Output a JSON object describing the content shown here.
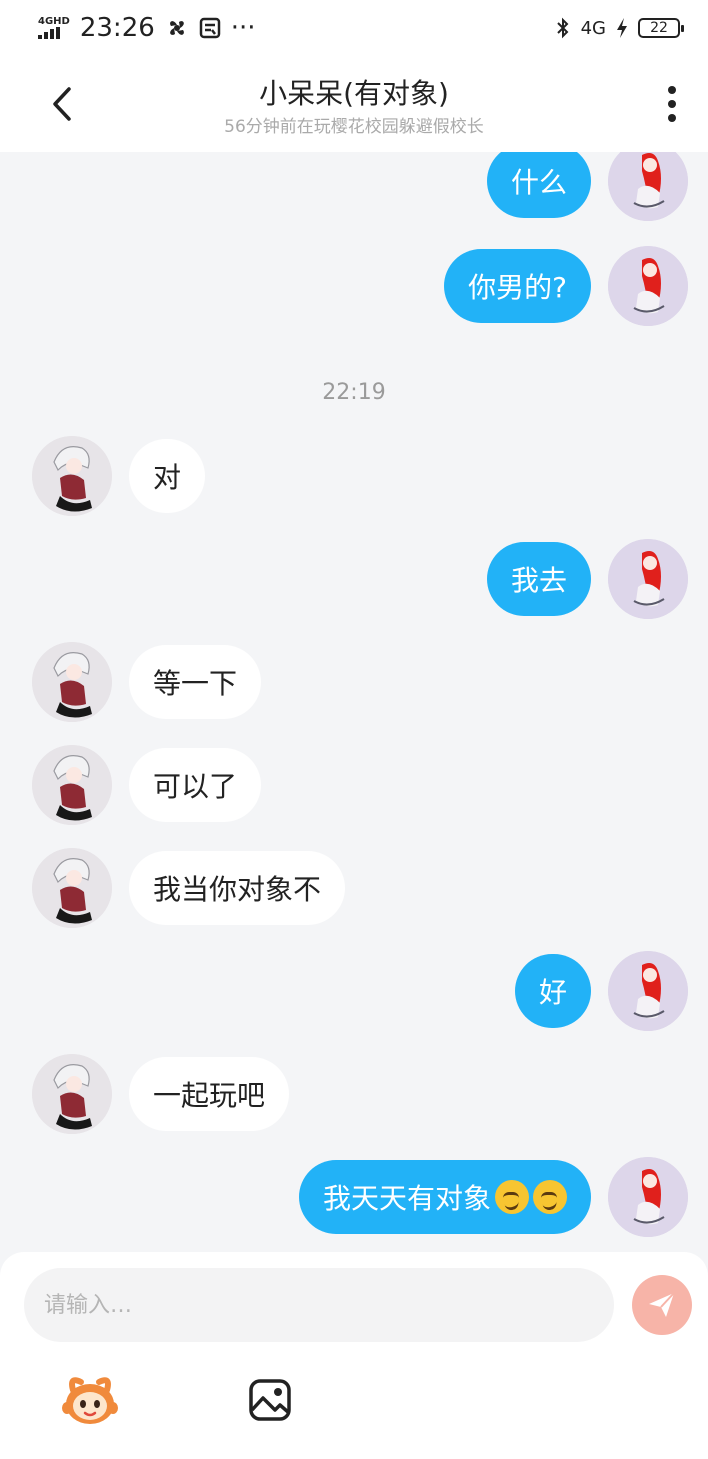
{
  "status_bar": {
    "network": "4GHD",
    "time": "23:26",
    "extra": "···",
    "right_network": "4G",
    "battery": "22"
  },
  "header": {
    "title": "小呆呆(有对象)",
    "subtitle": "56分钟前在玩樱花校园躲避假校长"
  },
  "messages": [
    {
      "side": "out",
      "text": "什么"
    },
    {
      "side": "out",
      "text": "你男的?"
    },
    {
      "side": "in",
      "text": "对"
    },
    {
      "side": "out",
      "text": "我去"
    },
    {
      "side": "in",
      "text": "等一下"
    },
    {
      "side": "in",
      "text": "可以了"
    },
    {
      "side": "in",
      "text": "我当你对象不"
    },
    {
      "side": "out",
      "text": "好"
    },
    {
      "side": "in",
      "text": "一起玩吧"
    },
    {
      "side": "out",
      "text": "我天天有对象",
      "emoji": [
        "smirk-emoji",
        "smirk-emoji"
      ]
    }
  ],
  "timestamp": "22:19",
  "composer": {
    "placeholder": "请输入…"
  },
  "icons": {
    "back": "chevron-left-icon",
    "more": "more-vertical-icon",
    "send": "send-icon",
    "sticker": "mascot-sticker-icon",
    "image": "image-icon"
  },
  "colors": {
    "outgoing_bubble": "#22b2f7",
    "incoming_bubble": "#ffffff",
    "background": "#f4f5f7",
    "send_button": "#f7b4a8"
  }
}
